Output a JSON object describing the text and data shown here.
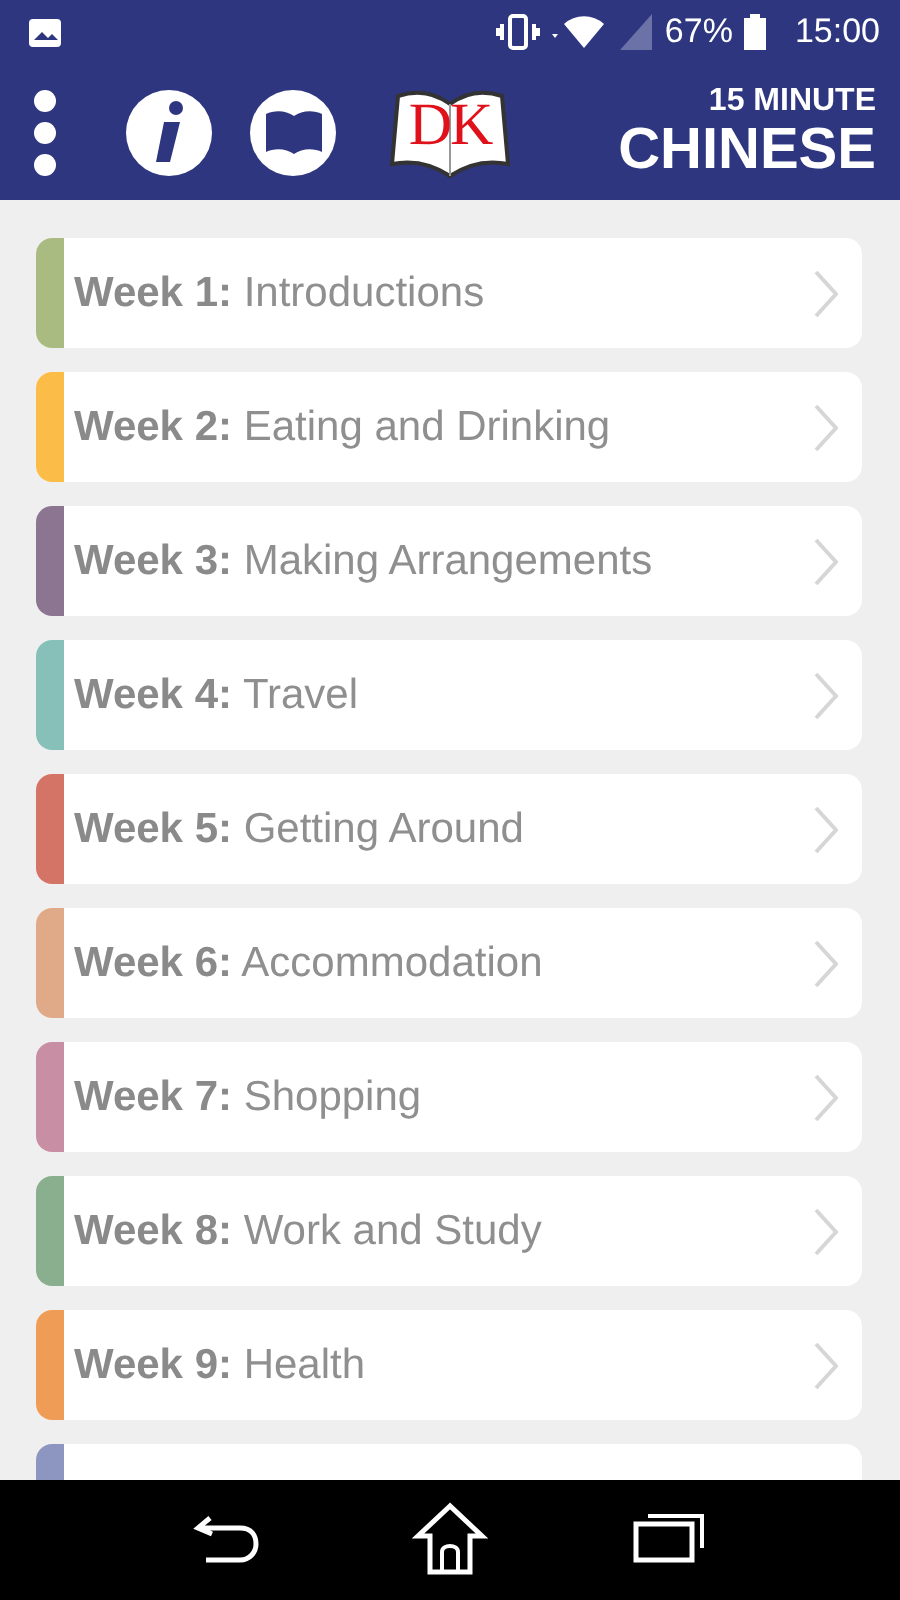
{
  "status_bar": {
    "battery": "67%",
    "time": "15:00"
  },
  "header": {
    "logo": "DK",
    "subtitle": "15 MINUTE",
    "title": "CHINESE"
  },
  "weeks": [
    {
      "week": "Week 1:",
      "title": "Introductions",
      "color": "#a9bb80"
    },
    {
      "week": "Week 2:",
      "title": "Eating and Drinking",
      "color": "#fbbd47"
    },
    {
      "week": "Week 3:",
      "title": "Making Arrangements",
      "color": "#8c7590"
    },
    {
      "week": "Week 4:",
      "title": "Travel",
      "color": "#86c0b8"
    },
    {
      "week": "Week 5:",
      "title": "Getting Around",
      "color": "#d47466"
    },
    {
      "week": "Week 6:",
      "title": "Accommodation",
      "color": "#e0a987"
    },
    {
      "week": "Week 7:",
      "title": "Shopping",
      "color": "#c88ea3"
    },
    {
      "week": "Week 8:",
      "title": "Work and Study",
      "color": "#8aaf8e"
    },
    {
      "week": "Week 9:",
      "title": "Health",
      "color": "#ef9c56"
    },
    {
      "color": "#8c96c0"
    }
  ]
}
